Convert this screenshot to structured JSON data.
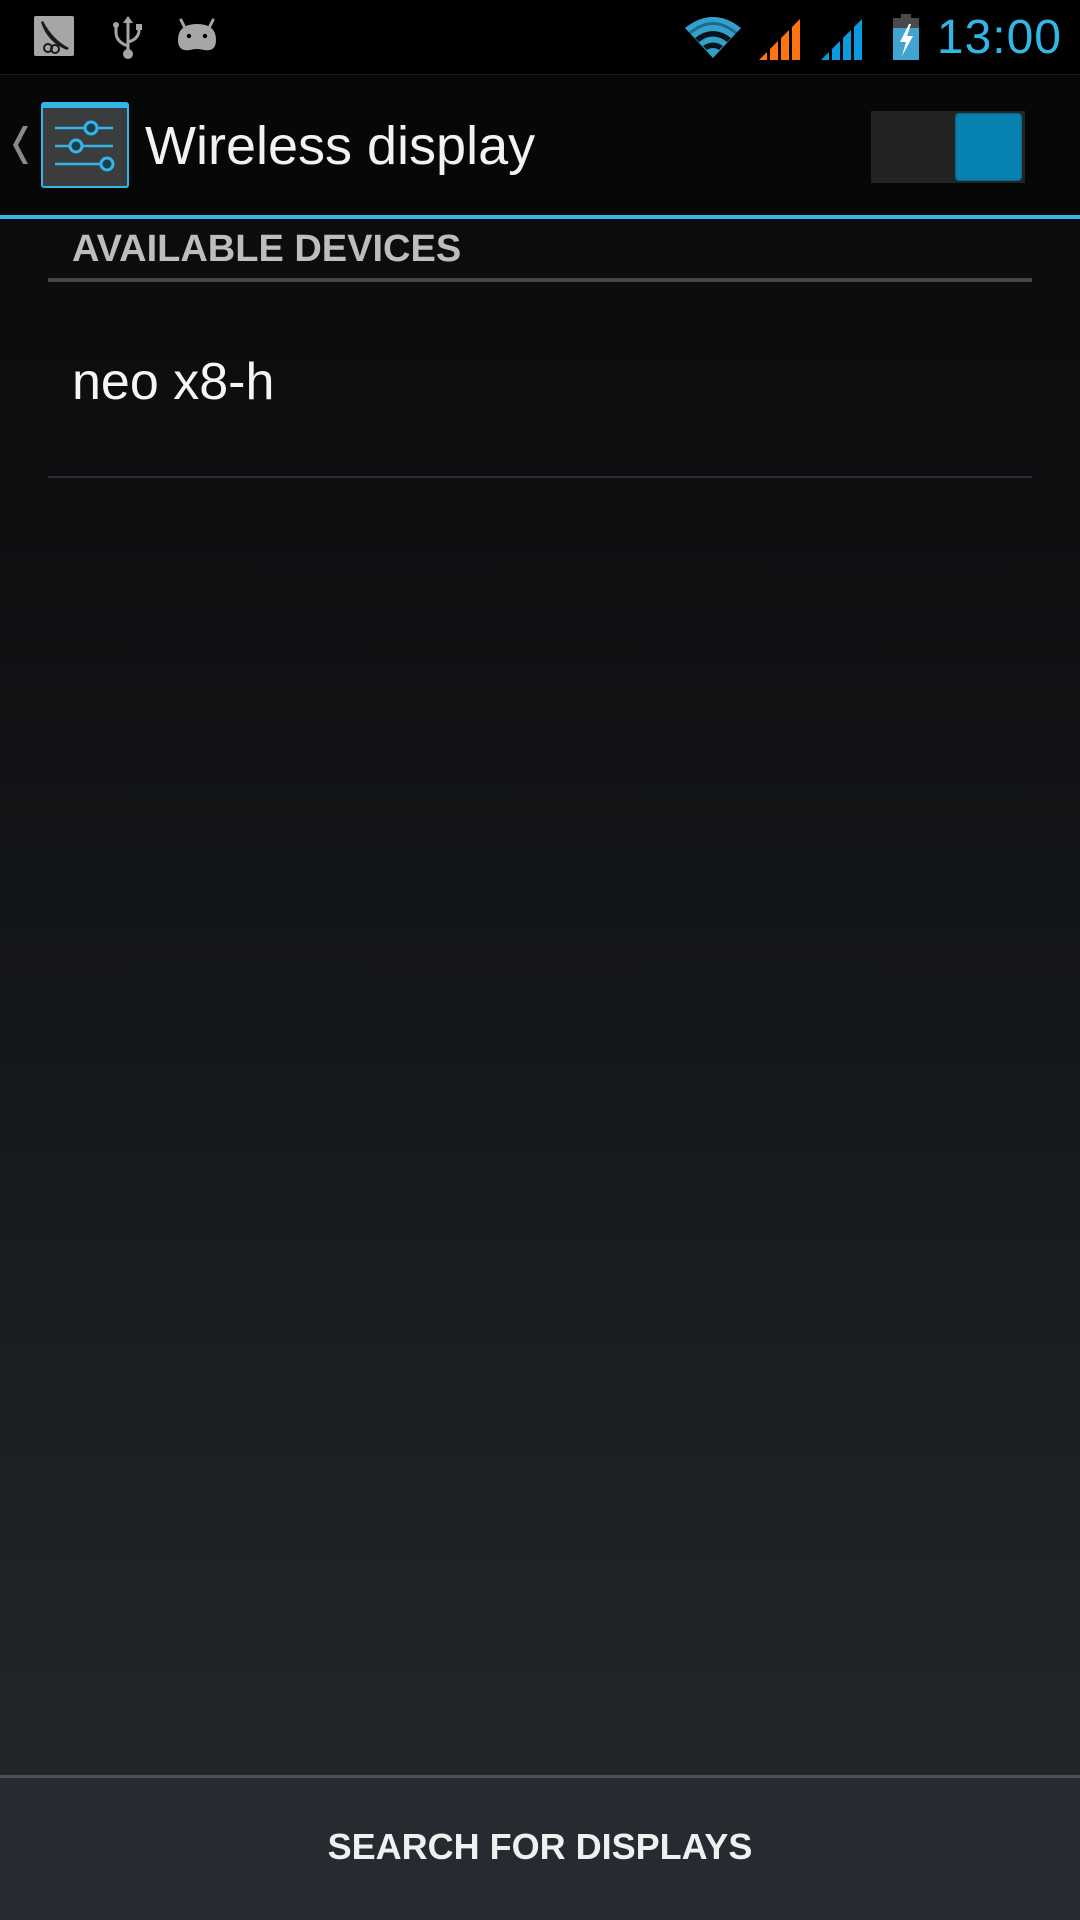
{
  "status_bar": {
    "notification_icons": [
      "app-notification-icon",
      "usb-icon",
      "android-debug-icon"
    ],
    "system_icons": [
      "wifi-icon",
      "signal-sim1-icon",
      "signal-sim2-icon",
      "battery-charging-icon"
    ],
    "time": "13:00",
    "colors": {
      "time": "#33b5e5",
      "wifi": "#33a0cc",
      "signal_sim1": "#ff7310",
      "signal_sim2": "#0a9ae0",
      "battery": "#3fa4d1"
    }
  },
  "action_bar": {
    "up_icon": "chevron-left-icon",
    "app_icon": "settings-sliders-icon",
    "title": "Wireless display",
    "toggle": {
      "state": "on",
      "accent": "#0882b0"
    },
    "accent_line": "#33b5e5"
  },
  "section": {
    "header": "AVAILABLE DEVICES",
    "devices": [
      {
        "name": "neo x8-h"
      }
    ]
  },
  "bottom_bar": {
    "button_label": "SEARCH FOR DISPLAYS"
  }
}
